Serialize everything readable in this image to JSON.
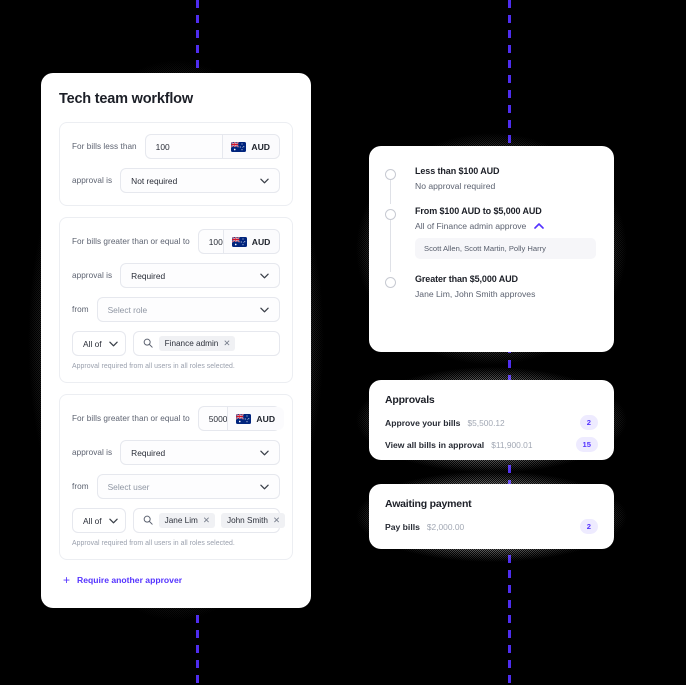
{
  "workflow": {
    "title": "Tech team workflow",
    "add_approver_label": "Require another approver",
    "rules": [
      {
        "threshold_label": "For bills less than",
        "amount": "100",
        "currency": "AUD",
        "approval_label": "approval is",
        "approval_value": "Not required"
      },
      {
        "threshold_label": "For bills greater than or equal to",
        "amount": "100",
        "currency": "AUD",
        "approval_label": "approval is",
        "approval_value": "Required",
        "from_label": "from",
        "from_value": "Select role",
        "quantifier": "All of",
        "tags": [
          "Finance admin"
        ],
        "hint": "Approval required from all users in all roles selected."
      },
      {
        "threshold_label": "For bills greater than or equal to",
        "amount": "5000",
        "currency": "AUD",
        "approval_label": "approval is",
        "approval_value": "Required",
        "from_label": "from",
        "from_value": "Select user",
        "quantifier": "All of",
        "tags": [
          "Jane Lim",
          "John Smith"
        ],
        "hint": "Approval required from all users in all roles selected."
      }
    ]
  },
  "timeline": {
    "items": [
      {
        "title": "Less than $100 AUD",
        "subtitle": "No approval required"
      },
      {
        "title": "From $100 AUD to $5,000 AUD",
        "subtitle": "All of Finance admin approve",
        "names": "Scott Allen, Scott Martin, Polly Harry"
      },
      {
        "title": "Greater than $5,000 AUD",
        "subtitle": "Jane Lim, John Smith approves"
      }
    ]
  },
  "approvals": {
    "title": "Approvals",
    "rows": [
      {
        "label": "Approve your bills",
        "amount": "$5,500.12",
        "count": "2"
      },
      {
        "label": "View all bills in approval",
        "amount": "$11,900.01",
        "count": "15"
      }
    ]
  },
  "awaiting": {
    "title": "Awaiting payment",
    "rows": [
      {
        "label": "Pay bills",
        "amount": "$2,000.00",
        "count": "2"
      }
    ]
  },
  "colors": {
    "accent": "#5433ff",
    "guide": "#4f2def",
    "badge_bg": "#eeebff",
    "text": "#1c1f27",
    "muted": "#8f96a3"
  }
}
